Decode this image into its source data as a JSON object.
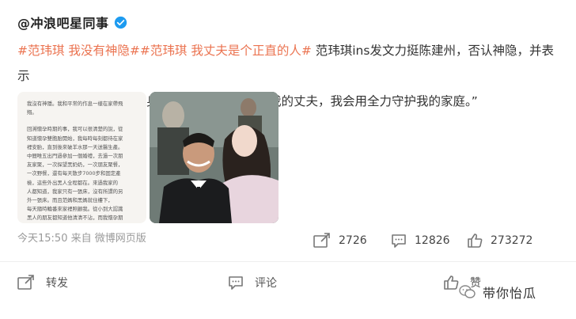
{
  "author": {
    "name": "@冲浪吧星同事"
  },
  "post": {
    "hashtag1": "#范玮琪 我没有神隐#",
    "hashtag2": "#范玮琪 我丈夫是个正直的人#",
    "text_after_tags": " 范玮琪ins发文力挺陈建州，否认神隐，并表示",
    "line2": "“我丈夫是个正直的人，身正不怕影子斜。我爱我的丈夫，我会用全力守护我的家庭。”"
  },
  "note_image": {
    "lines": [
      "我沒有神隱。我和平常的作息一樣在家帶飛",
      "翔。",
      "",
      "回溯懷孕時期的事，我可以很清楚的說，從",
      "知道懷孕雙胞胎開始，我每時每刻都待在家",
      "裡安胎，直到後來破羊水那一天送醫生產。",
      "中間唯五出門過參加一個婚禮，去過一次朋",
      "友家聚，一次探望黑奶奶，一次朋友聚餐，",
      "一次野餐，還有每天散步7000步和固定產",
      "檢，這些外出黑人全程都在。來過我家的",
      "人都知道，我家只有一張床，沒有所謂的另",
      "外一張床。而且范媽和黑媽就住樓下，",
      "每天隨時輪番來家裡照顧我。從小到大認識",
      "黑人的朋友都知道他清清不沾，而我懷孕期"
    ]
  },
  "meta": {
    "time": "今天15:50",
    "source": "来自 微博网页版"
  },
  "stats": {
    "reposts": "2726",
    "comments": "12826",
    "likes": "273272"
  },
  "actions": {
    "repost": "转发",
    "comment": "评论",
    "like": "赞"
  },
  "watermark": {
    "text": "带你怡瓜"
  },
  "colors": {
    "hashtag": "#eb7350",
    "verified": "#1d9bf0"
  }
}
